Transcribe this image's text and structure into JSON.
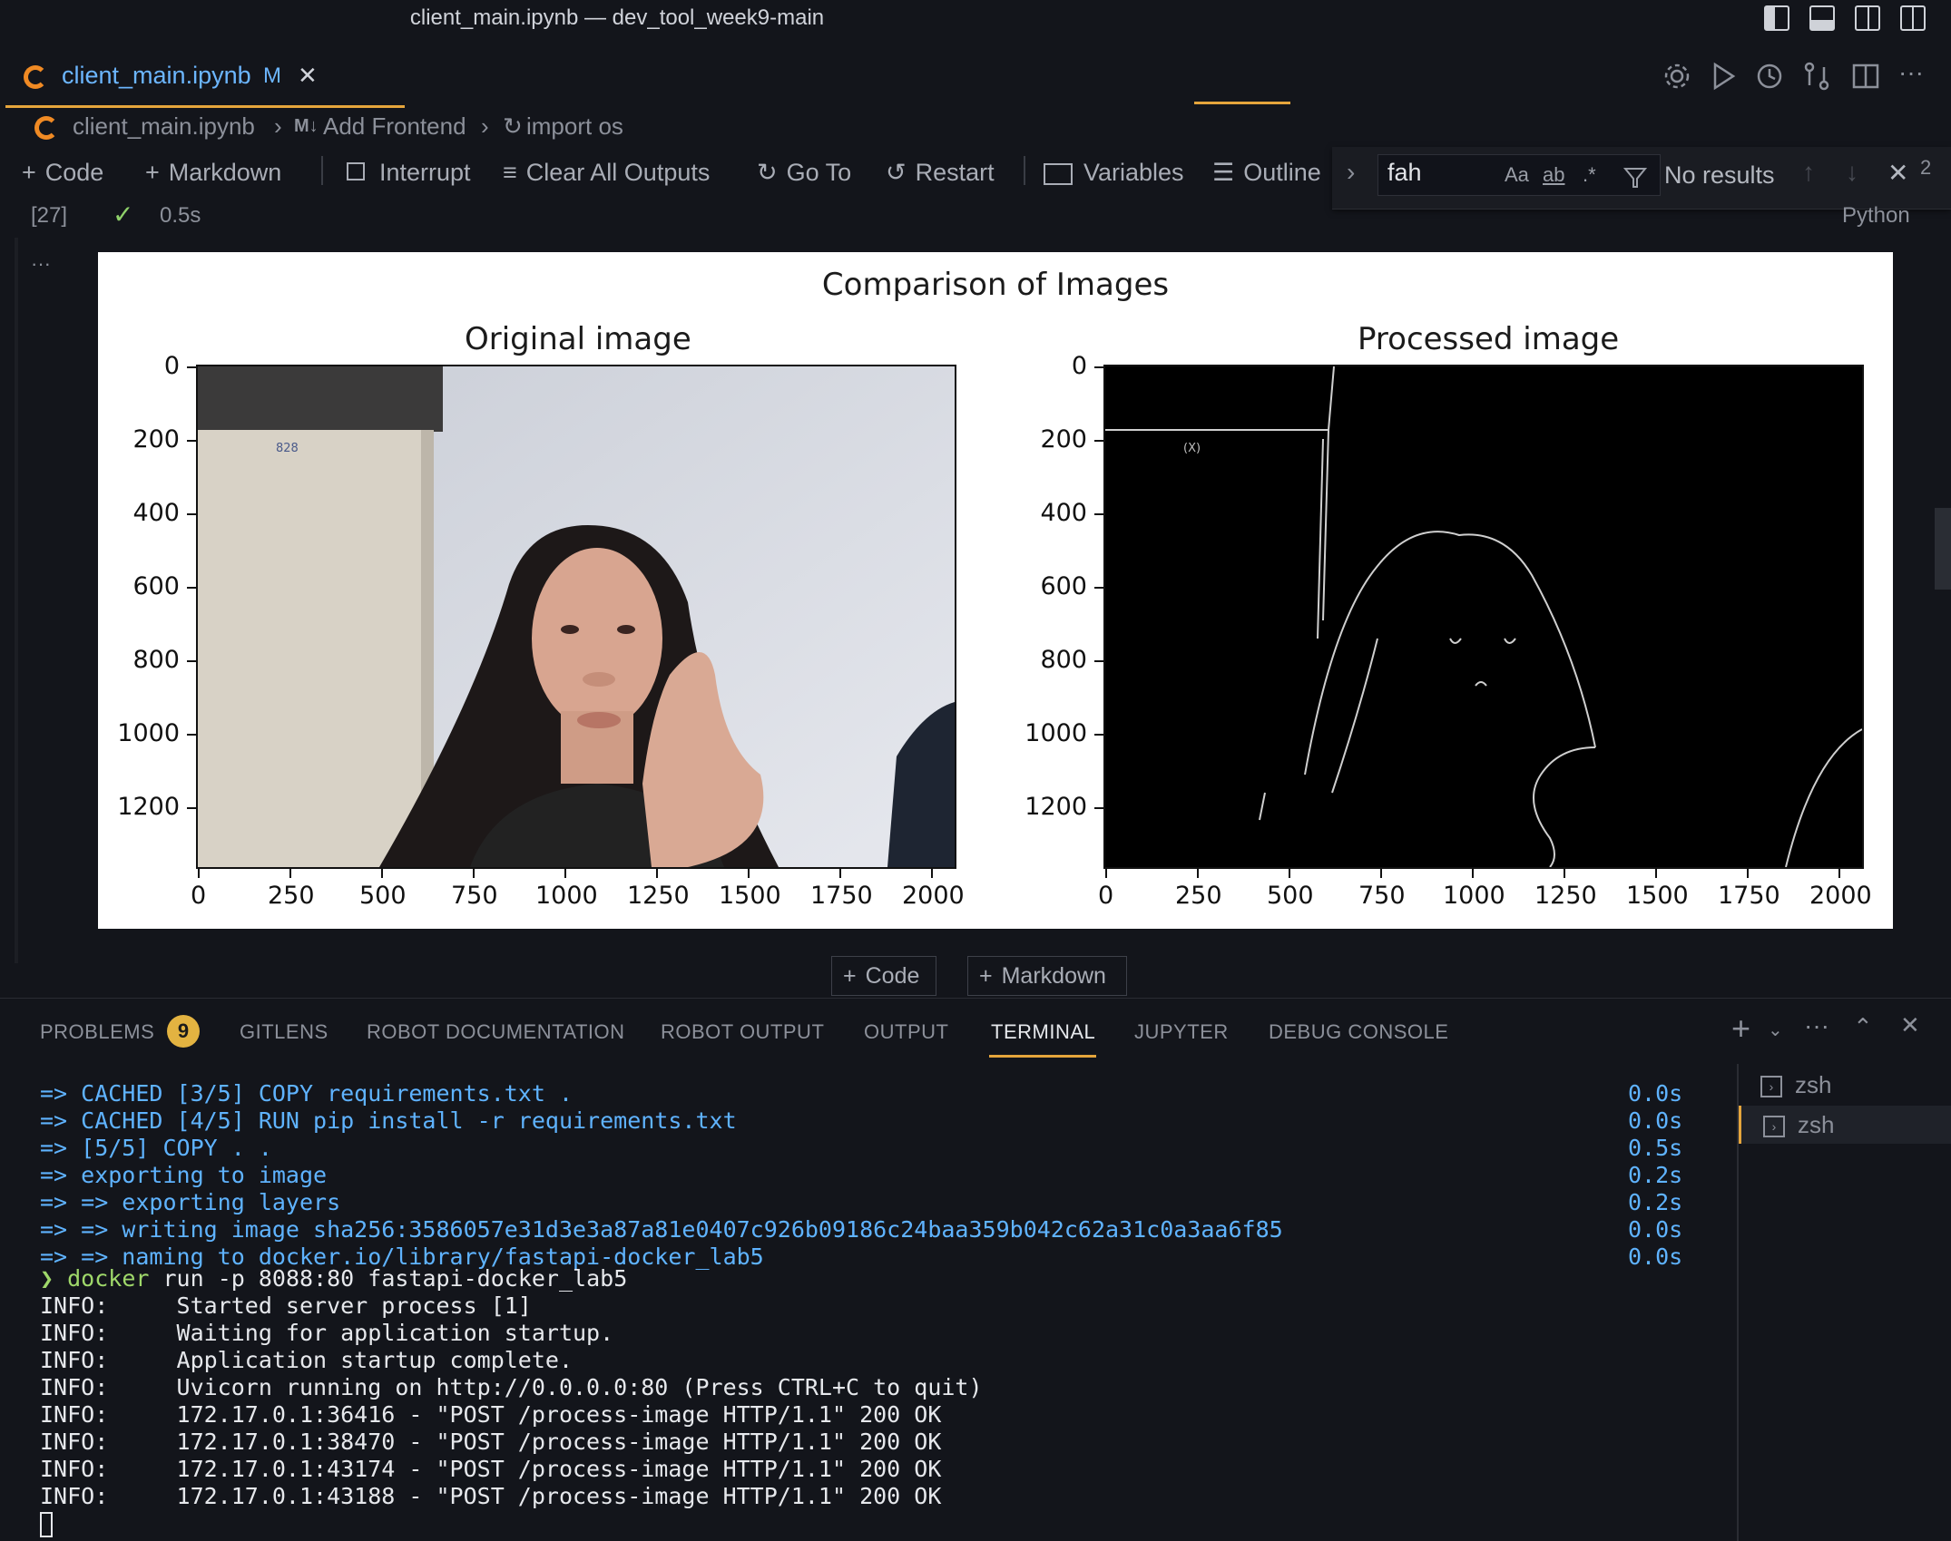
{
  "window": {
    "title": "client_main.ipynb — dev_tool_week9-main"
  },
  "tab": {
    "filename": "client_main.ipynb",
    "modified": "M",
    "close": "✕"
  },
  "breadcrumb": {
    "file": "client_main.ipynb",
    "section_tag": "M↓",
    "section": "Add Frontend",
    "cell": "import os"
  },
  "toolbar": {
    "code": "Code",
    "markdown": "Markdown",
    "interrupt": "Interrupt",
    "clear_all": "Clear All Outputs",
    "go_to": "Go To",
    "restart": "Restart",
    "variables": "Variables",
    "outline": "Outline"
  },
  "find": {
    "query": "fah",
    "match_case": "Aa",
    "whole_word": "ab",
    "regex": ".*",
    "result": "No results",
    "overflow_digit": "2"
  },
  "cell": {
    "exec_count": "[27]",
    "duration": "0.5s",
    "language": "Python",
    "more": "···"
  },
  "figure": {
    "title": "Comparison of Images",
    "left_title": "Original image",
    "right_title": "Processed image",
    "y_ticks": [
      "0",
      "200",
      "400",
      "600",
      "800",
      "1000",
      "1200"
    ],
    "x_ticks": [
      "0",
      "250",
      "500",
      "750",
      "1000",
      "1250",
      "1500",
      "1750",
      "2000"
    ],
    "door_label": "828",
    "edge_label": "(X)"
  },
  "add_cell": {
    "code": "Code",
    "markdown": "Markdown"
  },
  "panel": {
    "tabs": [
      "PROBLEMS",
      "GITLENS",
      "ROBOT DOCUMENTATION",
      "ROBOT OUTPUT",
      "OUTPUT",
      "TERMINAL",
      "JUPYTER",
      "DEBUG CONSOLE"
    ],
    "problems_count": "9",
    "active_tab": "TERMINAL"
  },
  "terminal": {
    "build_lines": [
      {
        "text": "=> CACHED [3/5] COPY requirements.txt .",
        "time": "0.0s"
      },
      {
        "text": "=> CACHED [4/5] RUN pip install -r requirements.txt",
        "time": "0.0s"
      },
      {
        "text": "=> [5/5] COPY . .",
        "time": "0.5s"
      },
      {
        "text": "=> exporting to image",
        "time": "0.2s"
      },
      {
        "text": "=> => exporting layers",
        "time": "0.2s"
      },
      {
        "text": "=> => writing image sha256:3586057e31d3e3a87a81e0407c926b09186c24baa359b042c62a31c0a3aa6f85",
        "time": "0.0s"
      },
      {
        "text": "=> => naming to docker.io/library/fastapi-docker_lab5",
        "time": "0.0s"
      }
    ],
    "prompt": "❯",
    "command": "docker",
    "command_args": "run -p 8088:80 fastapi-docker_lab5",
    "info_lines": [
      "INFO:     Started server process [1]",
      "INFO:     Waiting for application startup.",
      "INFO:     Application startup complete.",
      "INFO:     Uvicorn running on http://0.0.0.0:80 (Press CTRL+C to quit)",
      "INFO:     172.17.0.1:36416 - \"POST /process-image HTTP/1.1\" 200 OK",
      "INFO:     172.17.0.1:38470 - \"POST /process-image HTTP/1.1\" 200 OK",
      "INFO:     172.17.0.1:43174 - \"POST /process-image HTTP/1.1\" 200 OK",
      "INFO:     172.17.0.1:43188 - \"POST /process-image HTTP/1.1\" 200 OK"
    ],
    "sessions": [
      "zsh",
      "zsh"
    ]
  }
}
